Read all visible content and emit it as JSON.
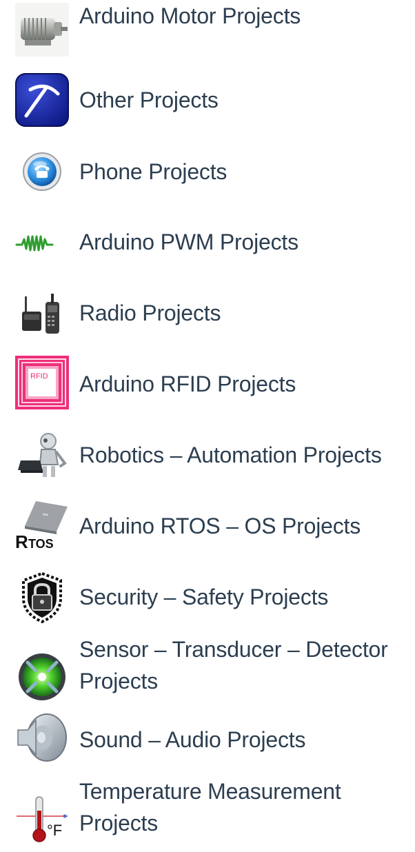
{
  "categories": [
    {
      "label": "Arduino Motor Projects",
      "icon": "motor-icon"
    },
    {
      "label": "Other Projects",
      "icon": "pickaxe-icon"
    },
    {
      "label": "Phone Projects",
      "icon": "phone-icon"
    },
    {
      "label": "Arduino PWM Projects",
      "icon": "pwm-wave-icon"
    },
    {
      "label": "Radio Projects",
      "icon": "radio-icon"
    },
    {
      "label": "Arduino RFID Projects",
      "icon": "rfid-icon"
    },
    {
      "label": "Robotics – Automation Projects",
      "icon": "robot-icon"
    },
    {
      "label": "Arduino RTOS – OS Projects",
      "icon": "rtos-icon"
    },
    {
      "label": "Security – Safety Projects",
      "icon": "padlock-shield-icon"
    },
    {
      "label": "Sensor – Transducer – Detector Projects",
      "icon": "sensor-icon"
    },
    {
      "label": "Sound – Audio Projects",
      "icon": "speaker-icon"
    },
    {
      "label": "Temperature Measurement Projects",
      "icon": "thermometer-icon"
    }
  ],
  "rtos_icon_text": {
    "main": "R",
    "sub": "TOS"
  },
  "rfid_icon_text": "RFID",
  "thermometer_unit": "°F"
}
